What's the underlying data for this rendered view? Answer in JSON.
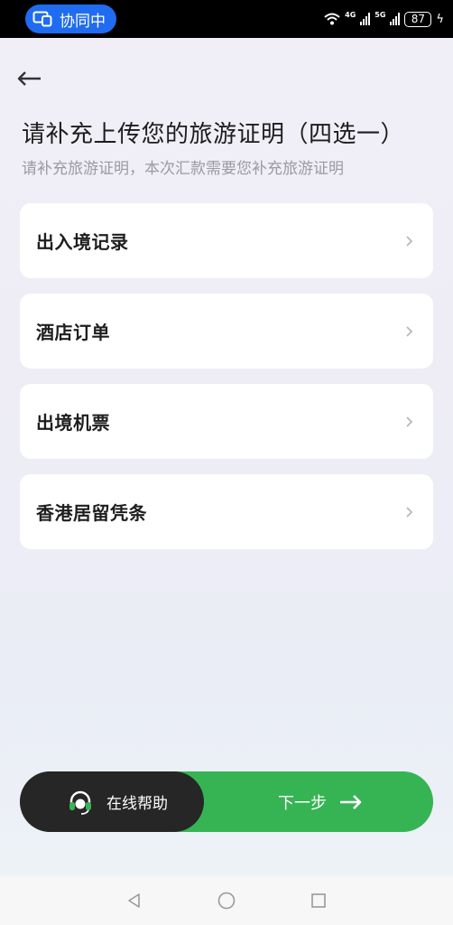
{
  "status_bar": {
    "collab_label": "协同中",
    "network_1": "4G",
    "network_2": "5G",
    "battery": "87"
  },
  "header": {
    "title": "请补充上传您的旅游证明（四选一）",
    "subtitle": "请补充旅游证明，本次汇款需要您补充旅游证明"
  },
  "options": [
    {
      "label": "出入境记录"
    },
    {
      "label": "酒店订单"
    },
    {
      "label": "出境机票"
    },
    {
      "label": "香港居留凭条"
    }
  ],
  "actions": {
    "help_label": "在线帮助",
    "next_label": "下一步"
  },
  "colors": {
    "accent_green": "#36b454",
    "help_bg": "#262626",
    "collab_blue": "#1f6cf0"
  }
}
